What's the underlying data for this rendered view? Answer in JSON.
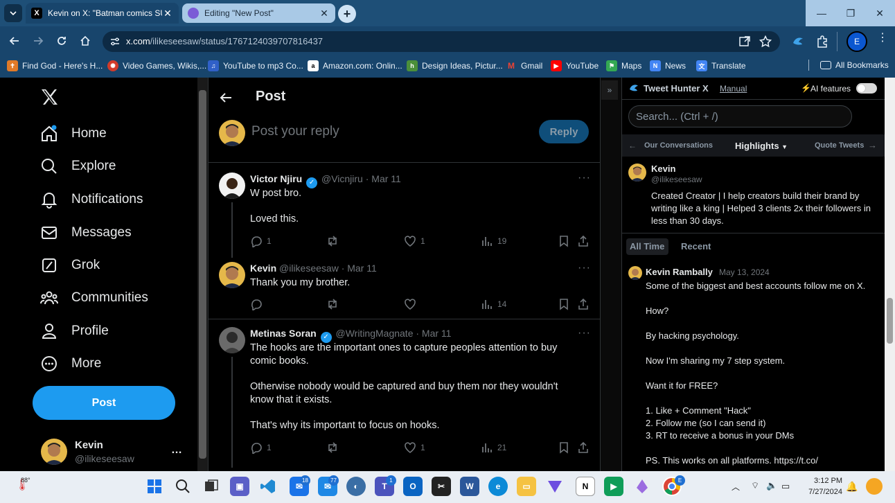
{
  "browser": {
    "tabs": [
      {
        "title": "Kevin on X: \"Batman comics SU",
        "active": true
      },
      {
        "title": "Editing \"New Post\"",
        "active": false
      }
    ],
    "url_host": "x.com",
    "url_path": "/ilikeseesaw/status/1767124039707816437",
    "profile_initial": "E",
    "bookmarks": [
      "Find God - Here's H...",
      "Video Games, Wikis,...",
      "YouTube to mp3 Co...",
      "Amazon.com: Onlin...",
      "Design Ideas, Pictur...",
      "Gmail",
      "YouTube",
      "Maps",
      "News",
      "Translate"
    ],
    "all_bookmarks": "All Bookmarks"
  },
  "nav": {
    "items": [
      "Home",
      "Explore",
      "Notifications",
      "Messages",
      "Grok",
      "Communities",
      "Profile",
      "More"
    ],
    "post_button": "Post",
    "account_name": "Kevin",
    "account_handle": "@ilikeseesaw",
    "account_more": "…"
  },
  "main": {
    "header_title": "Post",
    "reply_placeholder": "Post your reply",
    "reply_button": "Reply",
    "tweets": [
      {
        "name": "Victor Njiru",
        "handle": "@Vicnjiru",
        "date": "· Mar 11",
        "lines": [
          "W post bro.",
          "",
          "Loved this."
        ],
        "replies": "1",
        "retweets": "",
        "likes": "1",
        "views": "19"
      },
      {
        "name": "Kevin",
        "handle": "@ilikeseesaw",
        "date": "· Mar 11",
        "lines": [
          "Thank you my brother."
        ],
        "replies": "",
        "retweets": "",
        "likes": "",
        "views": "14"
      },
      {
        "name": "Metinas Soran",
        "handle": "@WritingMagnate",
        "date": "· Mar 11",
        "lines": [
          "The hooks are the important ones to capture peoples attention to buy",
          "comic books.",
          "",
          "Otherwise nobody would be captured and buy them nor they wouldn't",
          "know that it exists.",
          "",
          "That's why its important to focus on hooks."
        ],
        "replies": "1",
        "retweets": "",
        "likes": "1",
        "views": "21"
      }
    ]
  },
  "extension": {
    "title": "Tweet Hunter X",
    "manual": "Manual",
    "ai_features": "AI features",
    "search_placeholder": "Search... (Ctrl + /)",
    "nav_left": "Our Conversations",
    "nav_center": "Highlights",
    "nav_right": "Quote Tweets",
    "profile_name": "Kevin",
    "profile_handle": "@ilikeseesaw",
    "bio_lines": [
      "Created Creator | I help creators build their brand by",
      "writing like a king | Helped 3 clients 2x their followers in",
      "less than 30 days."
    ],
    "tab_all_time": "All Time",
    "tab_recent": "Recent",
    "post_author": "Kevin Rambally",
    "post_date": "May 13, 2024",
    "post_lines": [
      "Some of the biggest and best accounts follow me on X.",
      "How?",
      "By hacking psychology.",
      "Now I'm sharing my 7 step system.",
      "Want it for FREE?",
      "1. Like + Comment \"Hack\"",
      "2. Follow me (so I can send it)",
      "3. RT to receive a bonus in your DMs",
      "PS. This works on all platforms. https://t.co/"
    ]
  },
  "taskbar": {
    "weather_temp": "88°",
    "time": "3:12 PM",
    "date": "7/27/2024",
    "badges": {
      "mail": "18",
      "mail2": "77",
      "teams": "1"
    }
  },
  "colors": {
    "accent": "#1d9bf0",
    "chrome_tab": "#1e4f77",
    "chrome_toolbar": "#18456c"
  }
}
